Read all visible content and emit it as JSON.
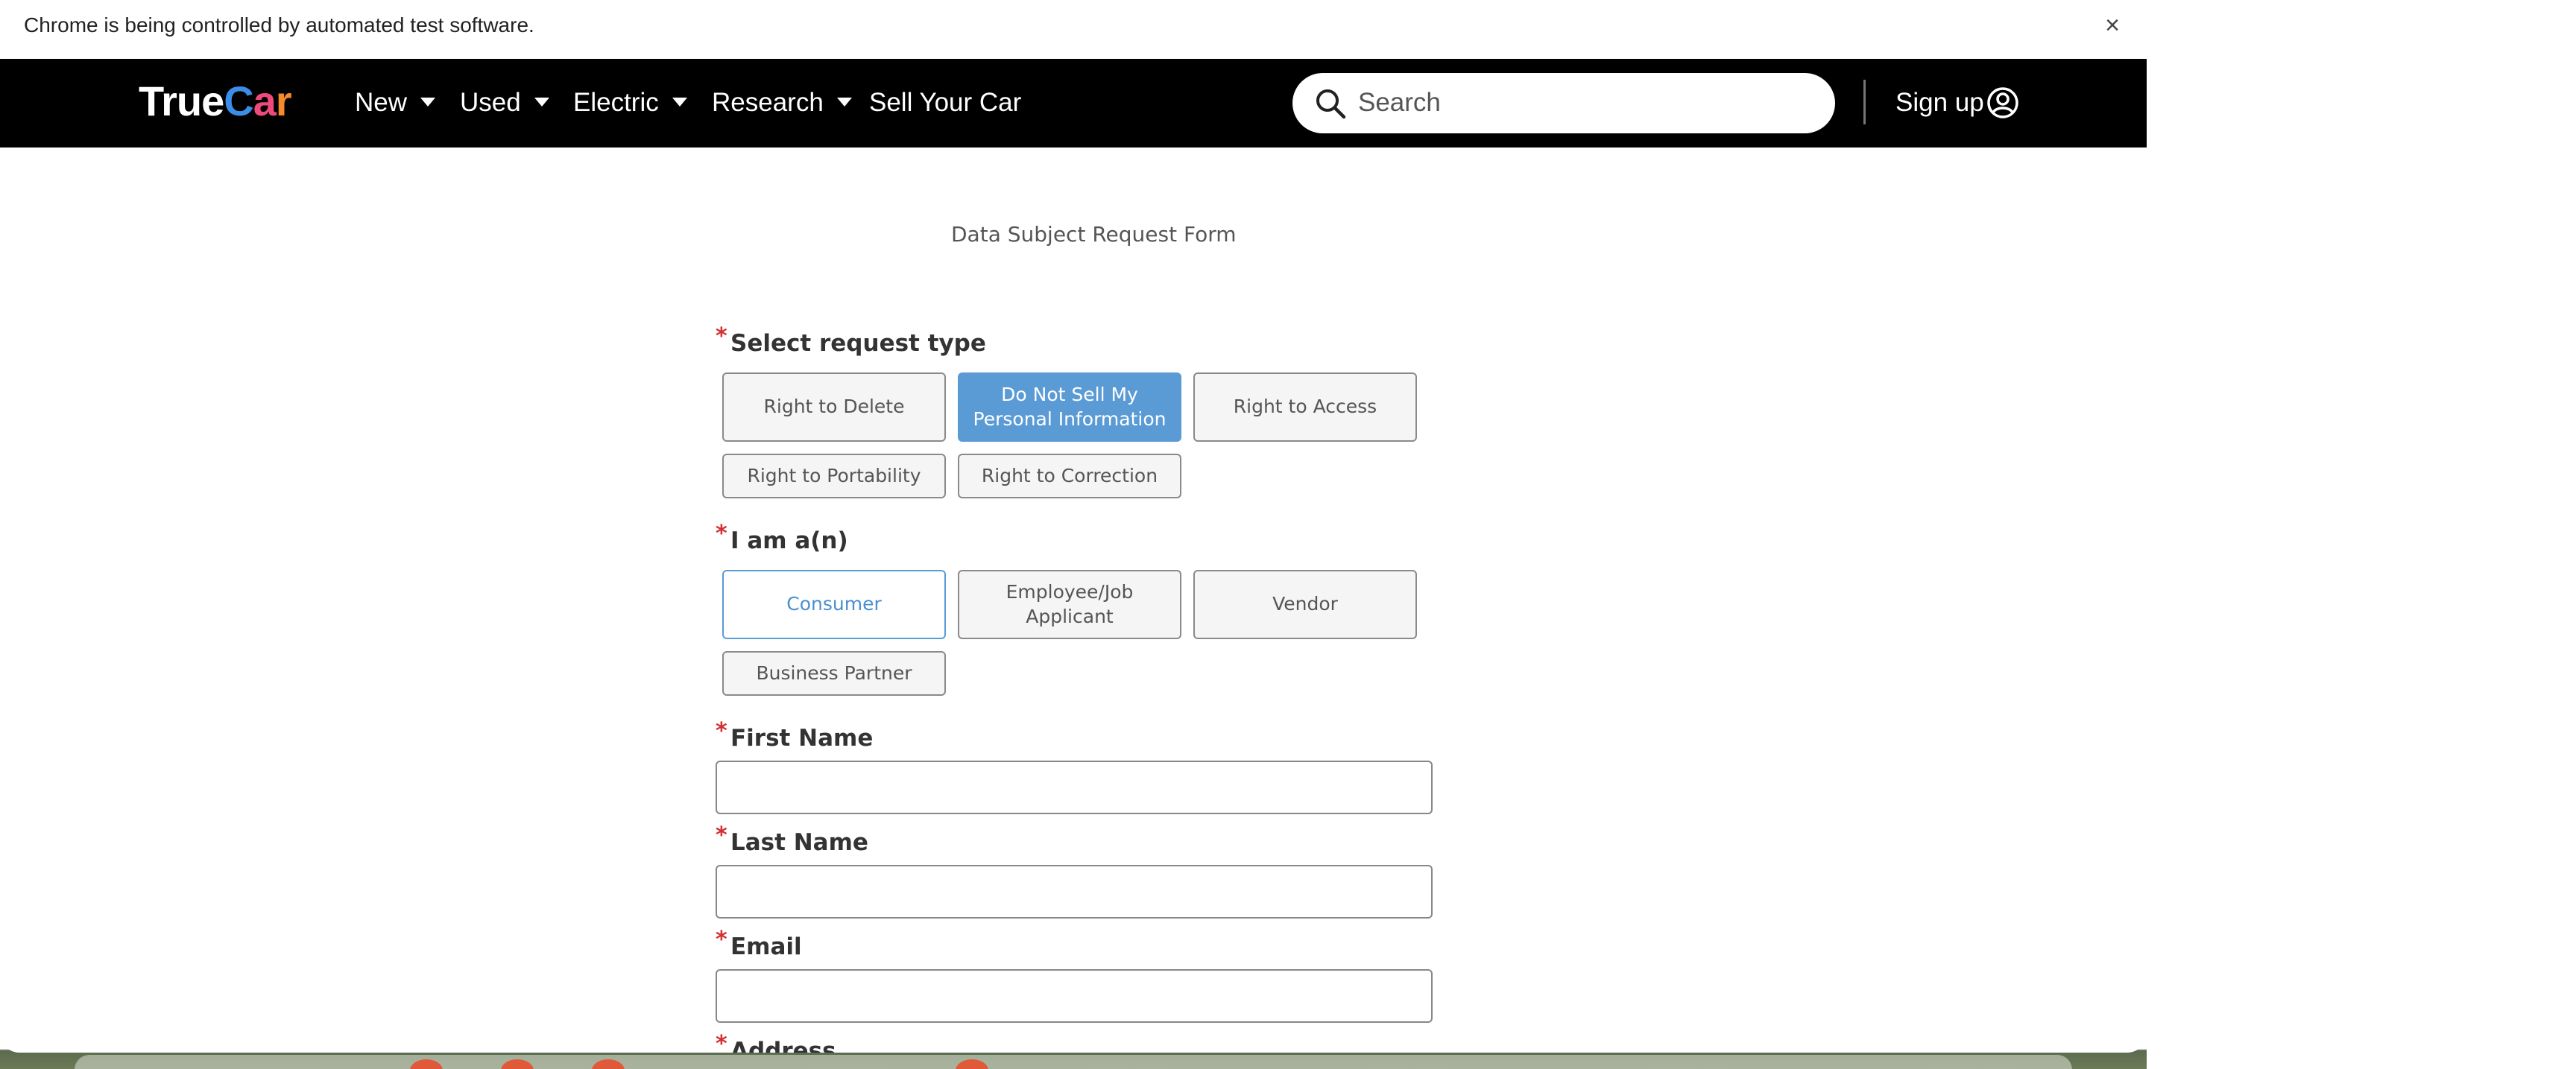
{
  "infobar": {
    "message": "Chrome is being controlled by automated test software.",
    "close_glyph": "×"
  },
  "header": {
    "logo": {
      "part1": "True",
      "c": "C",
      "a": "a",
      "r": "r"
    },
    "nav": [
      {
        "label": "New",
        "has_caret": true
      },
      {
        "label": "Used",
        "has_caret": true
      },
      {
        "label": "Electric",
        "has_caret": true
      },
      {
        "label": "Research",
        "has_caret": true
      },
      {
        "label": "Sell Your Car",
        "has_caret": false
      }
    ],
    "search_placeholder": "Search",
    "signup_label": "Sign up"
  },
  "form": {
    "title": "Data Subject Request Form",
    "required_marker": "*",
    "request_type": {
      "label": "Select request type",
      "options": [
        "Right to Delete",
        "Do Not Sell My Personal Information",
        "Right to Access",
        "Right to Portability",
        "Right to Correction"
      ],
      "selected": "Do Not Sell My Personal Information"
    },
    "role": {
      "label": "I am a(n)",
      "options": [
        "Consumer",
        "Employee/Job Applicant",
        "Vendor",
        "Business Partner"
      ],
      "selected": "Consumer"
    },
    "first_name": {
      "label": "First Name",
      "value": ""
    },
    "last_name": {
      "label": "Last Name",
      "value": ""
    },
    "email": {
      "label": "Email",
      "value": ""
    },
    "address": {
      "label": "Address"
    }
  },
  "colors": {
    "header_bg": "#000000",
    "selected_blue": "#5b9bd5",
    "required_red": "#d32f2f"
  }
}
